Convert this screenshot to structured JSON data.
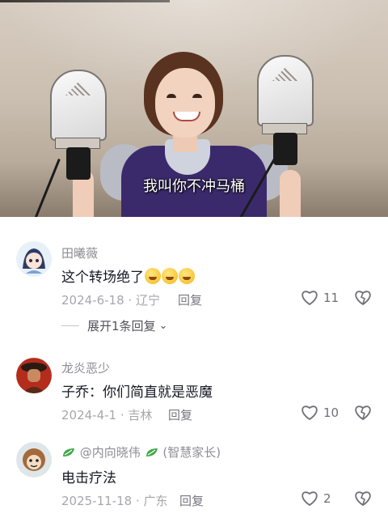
{
  "video": {
    "subtitle": "我叫你不冲马桶"
  },
  "comments": [
    {
      "username": "田曦薇",
      "text": "这个转场绝了",
      "emojis": [
        "laugh-cry-emoji",
        "laugh-cry-emoji",
        "laugh-cry-emoji"
      ],
      "date": "2024-6-18",
      "location": "辽宁",
      "reply_label": "回复",
      "likes": "11",
      "expand_label": "展开1条回复"
    },
    {
      "username": "龙炎恶少",
      "text": "子乔：你们简直就是恶魔",
      "date": "2024-4-1",
      "location": "吉林",
      "reply_label": "回复",
      "likes": "10"
    },
    {
      "username": "@内向晓伟",
      "username_suffix": "(智慧家长)",
      "text": "电击疗法",
      "date": "2025-11-18",
      "location": "广东",
      "reply_label": "回复",
      "likes": "2"
    }
  ],
  "colors": {
    "text": "#161823",
    "secondary": "#8e8e93",
    "accent_green": "#3ea84a"
  }
}
